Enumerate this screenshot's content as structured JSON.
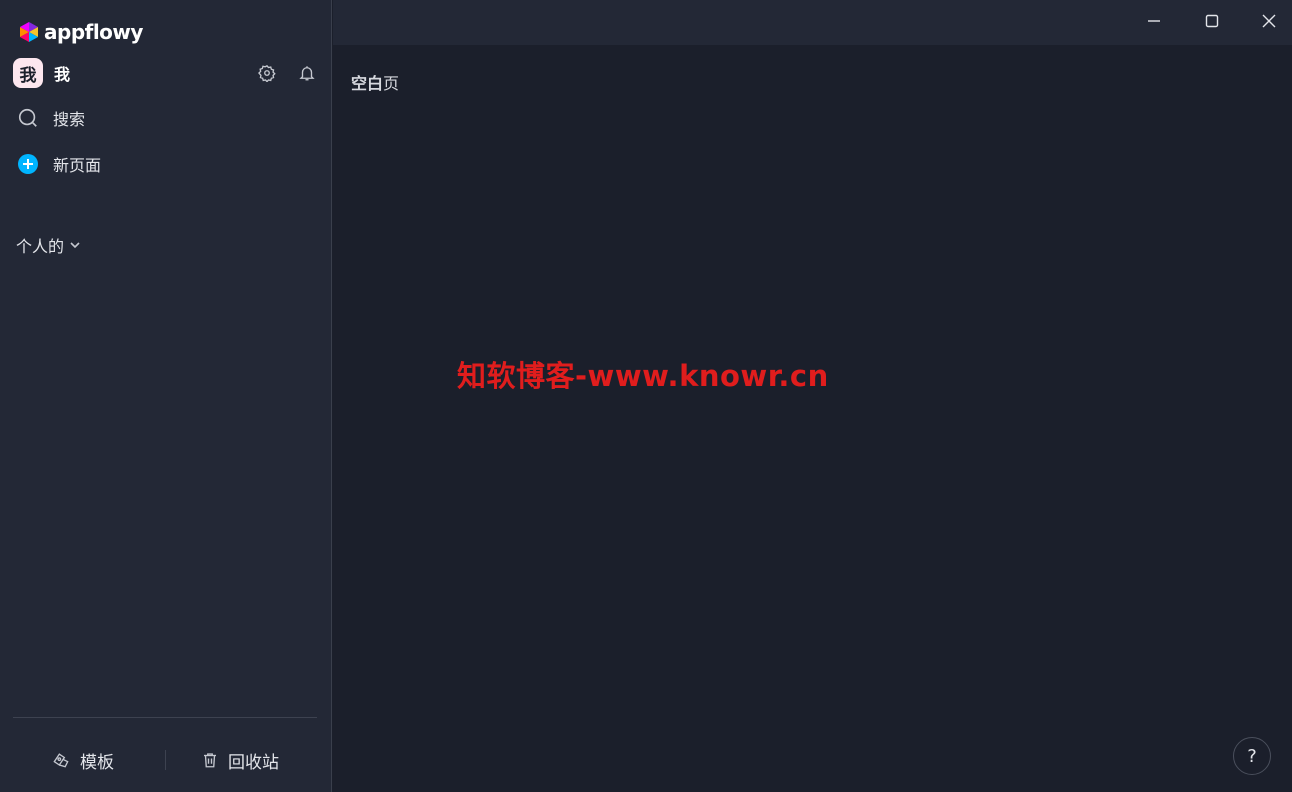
{
  "app": {
    "logo_text": "appflowy"
  },
  "user": {
    "avatar_text": "我",
    "name": "我"
  },
  "sidebar": {
    "search_label": "搜索",
    "new_page_label": "新页面",
    "section_label": "个人的",
    "templates_label": "模板",
    "trash_label": "回收站"
  },
  "main": {
    "breadcrumb_bold": "空白",
    "breadcrumb_rest": "页",
    "help_label": "?"
  },
  "watermark": "知软博客-www.knowr.cn",
  "colors": {
    "accent": "#00b5ff",
    "sidebar_bg": "#232836",
    "main_bg": "#1b1f2b",
    "watermark": "#e01d1d"
  }
}
